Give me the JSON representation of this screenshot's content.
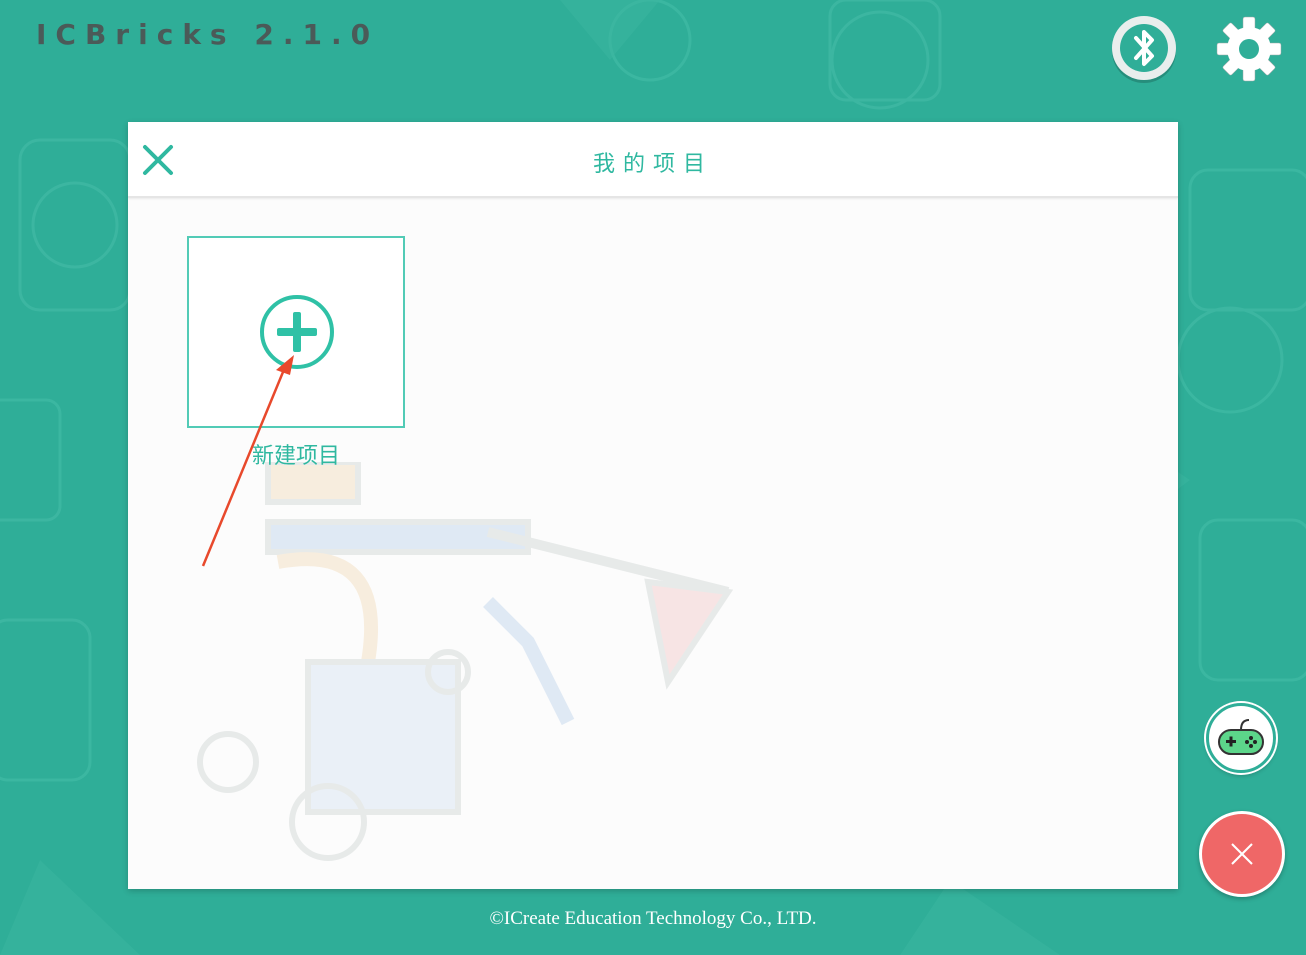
{
  "app": {
    "title": "ICBricks  2.1.0"
  },
  "toolbar": {
    "bluetooth_icon": "bluetooth-icon",
    "settings_icon": "gear-icon"
  },
  "dialog": {
    "title": "我的项目",
    "close_icon": "close-icon",
    "new_project": {
      "label": "新建项目",
      "icon": "plus-circle-icon"
    }
  },
  "footer": {
    "copyright": "©ICreate Education Technology Co., LTD."
  },
  "floating": {
    "gamepad_icon": "gamepad-icon",
    "close_icon": "close-icon"
  },
  "colors": {
    "background": "#2fae98",
    "accent": "#2fb8a0",
    "danger": "#ef6767",
    "title_text": "#4b5a58"
  }
}
